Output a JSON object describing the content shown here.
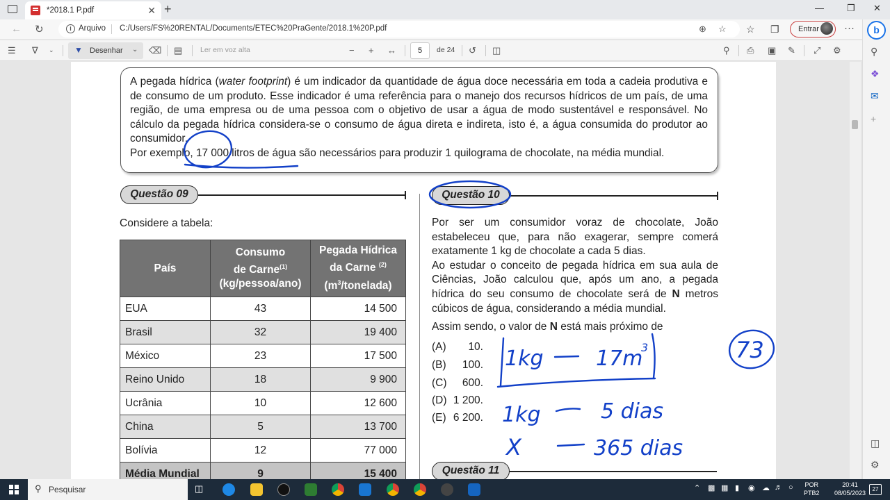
{
  "browser": {
    "tab_title": "*2018.1 P.pdf",
    "tab_close": "✕",
    "new_tab": "+",
    "address_label": "Arquivo",
    "url": "C:/Users/FS%20RENTAL/Documents/ETEC%20PraGente/2018.1%20P.pdf",
    "signin_label": "Entrar",
    "menu": "···"
  },
  "pdf_toolbar": {
    "draw_label": "Desenhar",
    "read_aloud_label": "Ler em voz alta",
    "current_page": "5",
    "page_total": "de 24"
  },
  "document": {
    "intro_line1_pre": "A pegada hídrica (",
    "intro_line1_em": "water footprint",
    "intro_line1_post": ") é um indicador da quantidade de água doce necessária em toda a cadeia produtiva e de consumo de um produto. Esse indicador é uma referência para o manejo dos recursos hídricos de um país, de uma região, de uma empresa ou de uma pessoa com o objetivo de usar a água de modo sustentável e responsável. No cálculo da pegada hídrica considera-se o consumo de água direta e indireta, isto é, a água consumida do produtor ao consumidor.",
    "intro_line2": "Por exemplo, 17 000 litros de água são necessários para produzir 1 quilograma de chocolate, na média mundial.",
    "q09_label": "Questão 09",
    "q09_intro": "Considere a tabela:",
    "table": {
      "h1": "País",
      "h2a": "Consumo",
      "h2b": "de Carne",
      "h2sup": "(1)",
      "h2c": "(kg/pessoa/ano)",
      "h3a": "Pegada Hídrica",
      "h3b": "da Carne",
      "h3sup": "(2)",
      "h3c1": "(m",
      "h3csup": "3",
      "h3c2": "/tonelada)",
      "rows": [
        {
          "country": "EUA",
          "consumption": "43",
          "footprint": "14 500"
        },
        {
          "country": "Brasil",
          "consumption": "32",
          "footprint": "19 400"
        },
        {
          "country": "México",
          "consumption": "23",
          "footprint": "17 500"
        },
        {
          "country": "Reino Unido",
          "consumption": "18",
          "footprint": "9 900"
        },
        {
          "country": "Ucrânia",
          "consumption": "10",
          "footprint": "12 600"
        },
        {
          "country": "China",
          "consumption": "5",
          "footprint": "13 700"
        },
        {
          "country": "Bolívia",
          "consumption": "12",
          "footprint": "77 000"
        },
        {
          "country": "Média Mundial",
          "consumption": "9",
          "footprint": "15 400"
        }
      ]
    },
    "q10_label": "Questão 10",
    "q10_p1": "Por ser um consumidor voraz de chocolate, João estabeleceu que, para não exagerar, sempre comerá exatamente 1 kg de chocolate a cada 5 dias.",
    "q10_p2_pre": "Ao estudar o conceito de pegada hídrica em sua aula de Ciências, João calculou que, após um ano, a pegada hídrica do seu consumo de chocolate será de ",
    "q10_p2_bold": "N",
    "q10_p2_post": " metros cúbicos de água, considerando a média mundial.",
    "q10_ask_pre": "Assim sendo, o valor de ",
    "q10_ask_bold": "N",
    "q10_ask_post": " está mais próximo de",
    "options": [
      {
        "letter": "(A)",
        "value": "10."
      },
      {
        "letter": "(B)",
        "value": "100."
      },
      {
        "letter": "(C)",
        "value": "600."
      },
      {
        "letter": "(D)",
        "value": "1 200."
      },
      {
        "letter": "(E)",
        "value": "6 200."
      }
    ],
    "q11_label": "Questão 11"
  },
  "handwriting": {
    "line1_left": "1kg",
    "line1_right": "17m",
    "line1_sup": "3",
    "line2_left": "1kg",
    "line2_right": "5 dias",
    "line3_left": "X",
    "line3_right": "365 dias",
    "circled_answer": "73",
    "ink_color": "#1240c8"
  },
  "taskbar": {
    "search_placeholder": "Pesquisar",
    "lang_top": "POR",
    "lang_bottom": "PTB2",
    "time": "20:41",
    "date": "08/05/2023",
    "notif_count": "27"
  }
}
